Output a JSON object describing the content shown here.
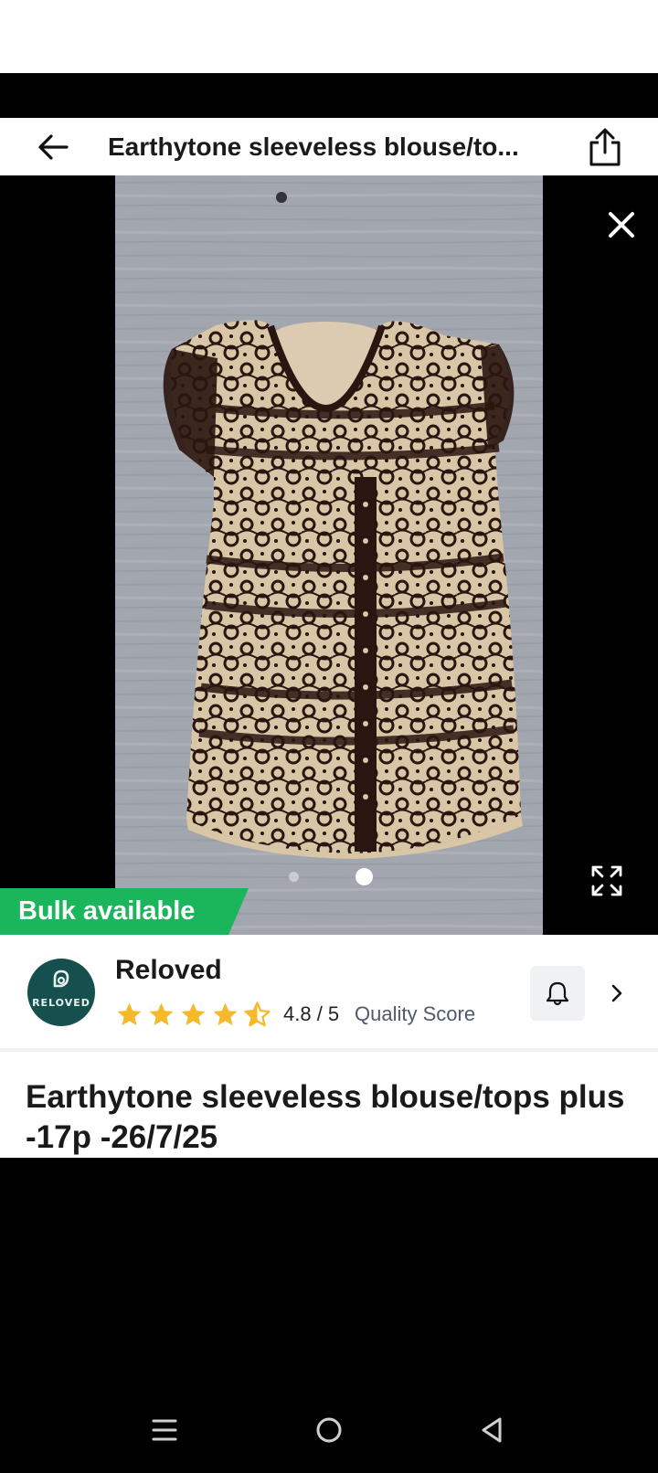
{
  "header": {
    "title": "Earthytone sleeveless blouse/to...",
    "back_icon": "arrow-left-icon",
    "share_icon": "share-icon"
  },
  "gallery": {
    "badge": "Bulk available",
    "badge_color": "#1bb55c",
    "page_count": 2,
    "current_page": 2
  },
  "seller": {
    "name": "Reloved",
    "avatar_text": "RELOVED",
    "avatar_color": "#16504e",
    "rating": "4.8 / 5",
    "rating_value": 4.5,
    "quality_label": "Quality Score",
    "star_color": "#f6b92b"
  },
  "product": {
    "title": "Earthytone sleeveless blouse/tops plus -17p -26/7/25"
  }
}
